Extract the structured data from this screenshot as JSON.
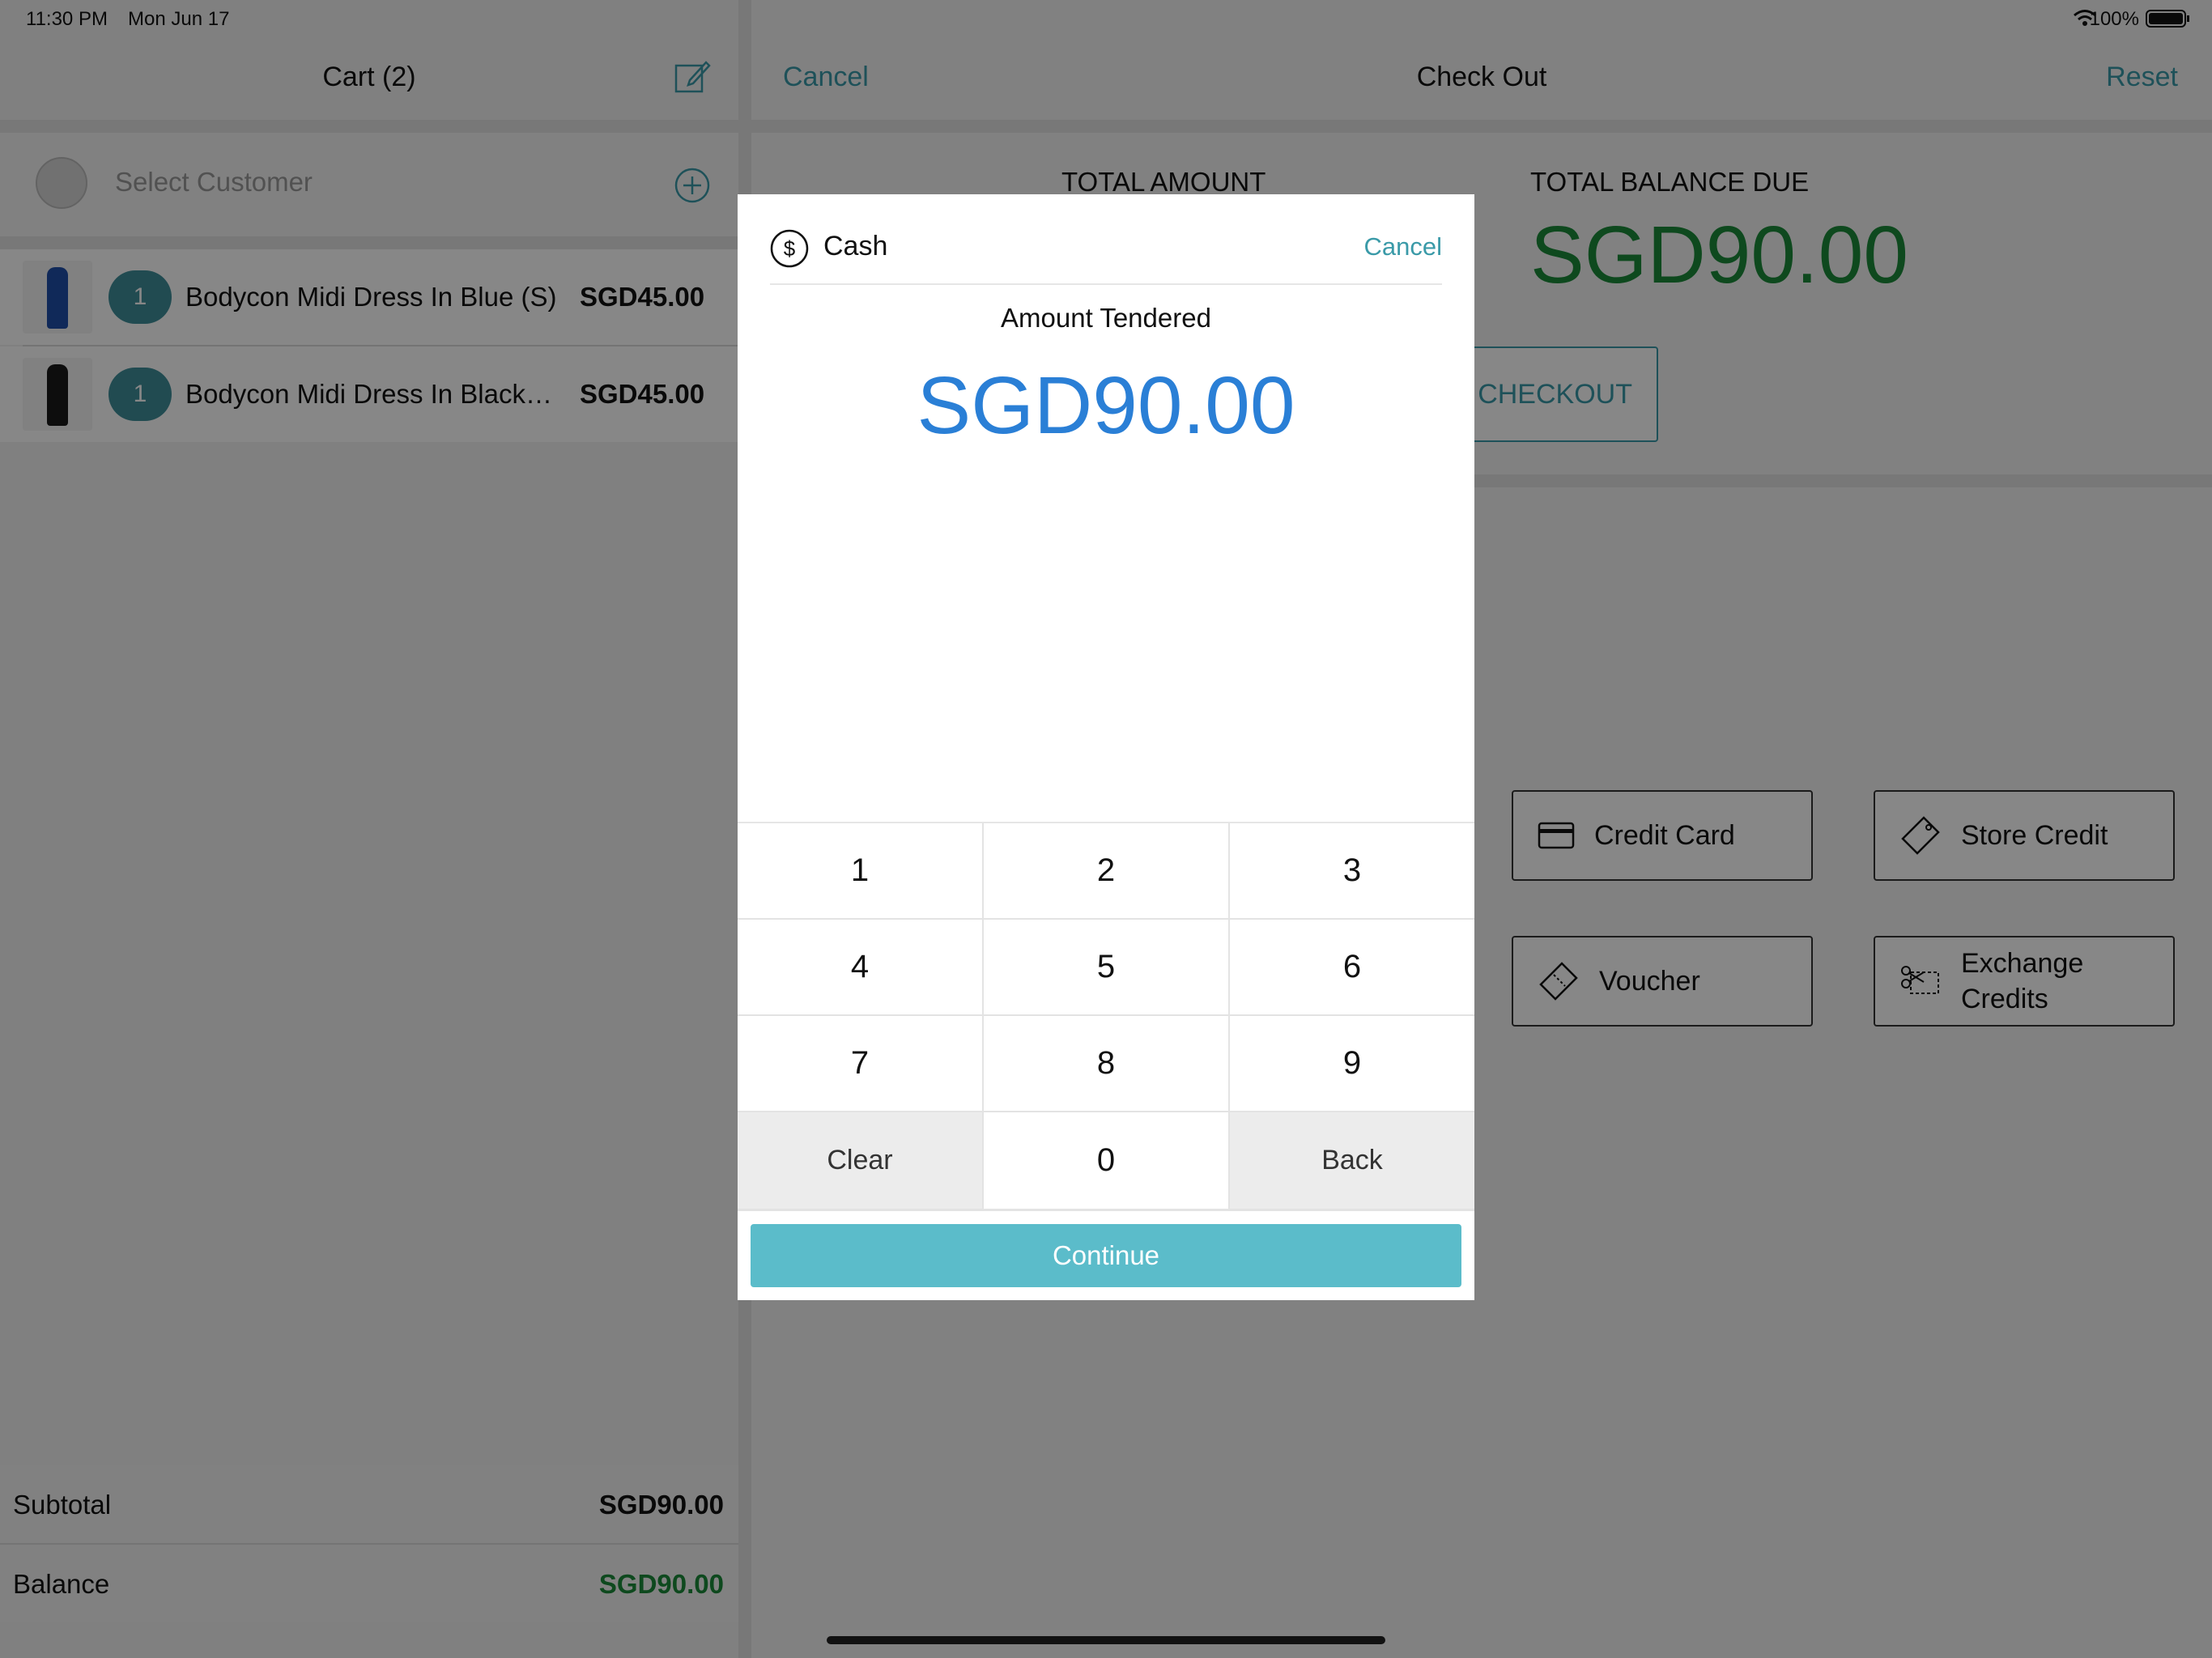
{
  "status_bar": {
    "time": "11:30 PM",
    "date": "Mon Jun 17",
    "battery": "100%"
  },
  "cart": {
    "title": "Cart (2)",
    "select_customer": "Select Customer",
    "items": [
      {
        "qty": "1",
        "name": "Bodycon Midi Dress In Blue (S)",
        "price": "SGD45.00",
        "thumb_color": "#1f4fa8"
      },
      {
        "qty": "1",
        "name": "Bodycon Midi Dress In Black…",
        "price": "SGD45.00",
        "thumb_color": "#1a1a1a"
      }
    ],
    "subtotal_label": "Subtotal",
    "subtotal_value": "SGD90.00",
    "balance_label": "Balance",
    "balance_value": "SGD90.00"
  },
  "checkout": {
    "cancel": "Cancel",
    "title": "Check Out",
    "reset": "Reset",
    "total_amount_label": "TOTAL AMOUNT",
    "total_balance_due_label": "TOTAL BALANCE DUE",
    "total_balance_due_value": "SGD90.00",
    "checkout_button": "CHECKOUT",
    "payment_methods": [
      {
        "label": "Credit Card",
        "icon": "credit-card-icon"
      },
      {
        "label": "Store Credit",
        "icon": "tag-icon"
      },
      {
        "label": "Voucher",
        "icon": "ticket-icon"
      },
      {
        "label": "Exchange Credits",
        "icon": "scissors-coupon-icon"
      }
    ]
  },
  "cash_modal": {
    "title": "Cash",
    "cancel": "Cancel",
    "amount_label": "Amount Tendered",
    "amount_value": "SGD90.00",
    "keys": [
      "1",
      "2",
      "3",
      "4",
      "5",
      "6",
      "7",
      "8",
      "9"
    ],
    "clear": "Clear",
    "zero": "0",
    "back": "Back",
    "continue": "Continue"
  },
  "colors": {
    "teal": "#3a9aa8",
    "green": "#1c8a3a",
    "blue": "#2a7fd6",
    "continue_bg": "#5bbcca"
  }
}
